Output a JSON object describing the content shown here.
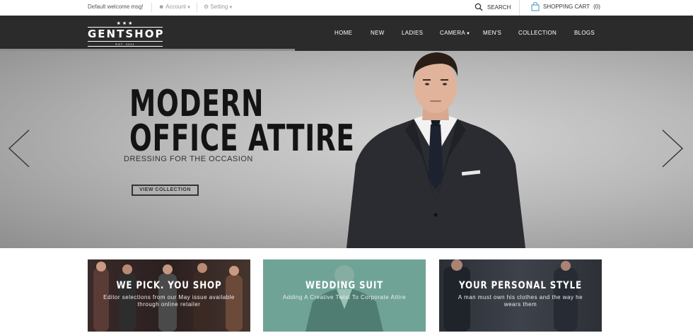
{
  "topbar": {
    "welcome": "Default welcome msg!",
    "account": "Account",
    "setting": "Setting",
    "search": "SEARCH",
    "cart_label": "SHOPPING CART",
    "cart_count": "(0)"
  },
  "logo": {
    "name": "GENTSHOP",
    "est": "EST. 2011"
  },
  "nav": [
    {
      "label": "HOME"
    },
    {
      "label": "NEW"
    },
    {
      "label": "LADIES"
    },
    {
      "label": "CAMERA"
    },
    {
      "label": "MEN'S"
    },
    {
      "label": "COLLECTION"
    },
    {
      "label": "BLOGS"
    }
  ],
  "hero": {
    "line1": "MODERN",
    "line2": "OFFICE ATTIRE",
    "subtitle": "DRESSING FOR THE OCCASION",
    "cta": "VIEW COLLECTION"
  },
  "cards": [
    {
      "title": "WE PICK. YOU SHOP",
      "desc": "Editor selections from our May issue available through online retailer"
    },
    {
      "title": "WEDDING SUIT",
      "desc": "Adding A Creative Twist To Corporate Attire"
    },
    {
      "title": "YOUR PERSONAL STYLE",
      "desc": "A man must own his clothes and the way he wears them"
    }
  ],
  "colors": {
    "header_bg": "#2b2b2b",
    "accent_teal": "#6fa396"
  }
}
